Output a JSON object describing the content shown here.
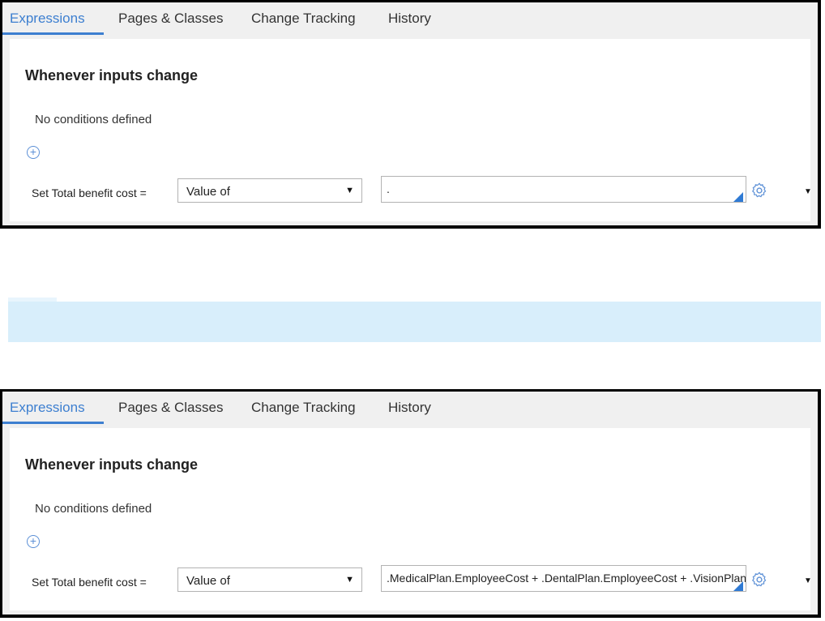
{
  "panels": [
    {
      "tabs": [
        "Expressions",
        "Pages & Classes",
        "Change Tracking",
        "History"
      ],
      "heading": "Whenever inputs change",
      "no_conditions": "No conditions defined",
      "set_label": "Set Total benefit cost =",
      "select_value": "Value of",
      "expression": "."
    },
    {
      "tabs": [
        "Expressions",
        "Pages & Classes",
        "Change Tracking",
        "History"
      ],
      "heading": "Whenever inputs change",
      "no_conditions": "No conditions defined",
      "set_label": "Set Total benefit cost =",
      "select_value": "Value of",
      "expression": ".MedicalPlan.EmployeeCost + .DentalPlan.EmployeeCost + .VisionPlan.EmployeeCost"
    }
  ],
  "icons": {
    "add": "plus-circle-icon",
    "settings": "gear-icon",
    "dropdown": "caret-down-icon"
  },
  "colors": {
    "accent": "#3d7fd0",
    "banner": "#d8eefb"
  }
}
